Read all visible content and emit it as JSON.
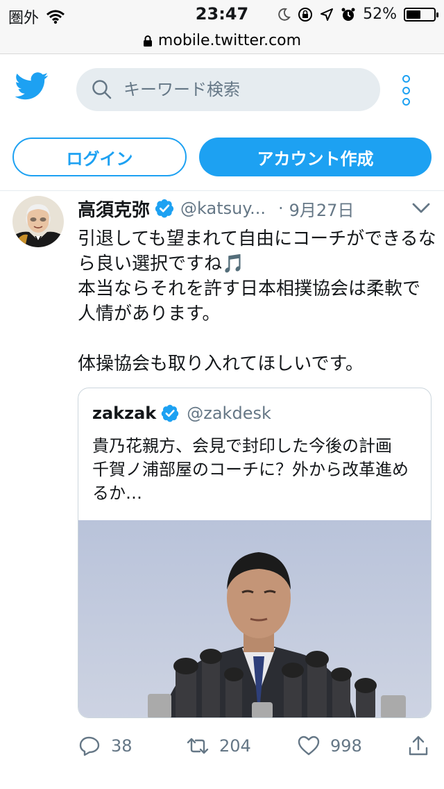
{
  "status_bar": {
    "carrier": "圏外",
    "time": "23:47",
    "battery_percent": "52%",
    "battery_level": 0.52
  },
  "url_bar": {
    "url": "mobile.twitter.com"
  },
  "header": {
    "logo_icon": "twitter-bird-icon",
    "search_placeholder": "キーワード検索",
    "menu_icon": "more-vertical-icon",
    "accent_color": "#1da1f2"
  },
  "auth": {
    "login_label": "ログイン",
    "signup_label": "アカウント作成"
  },
  "tweet": {
    "author_name": "高須克弥",
    "handle": "@katsuy...",
    "separator": "·",
    "date": "9月27日",
    "text": "引退しても望まれて自由にコーチができるなら良い選択ですね🎵\n本当ならそれを許す日本相撲協会は柔軟で人情があります。\n\n体操協会も取り入れてほしいです。",
    "quote": {
      "name": "zakzak",
      "handle": "@zakdesk",
      "text": "貴乃花親方、会見で封印した今後の計画　千賀ノ浦部屋のコーチに？外から改革進めるか…"
    },
    "actions": {
      "replies": "38",
      "retweets": "204",
      "likes": "998"
    }
  }
}
